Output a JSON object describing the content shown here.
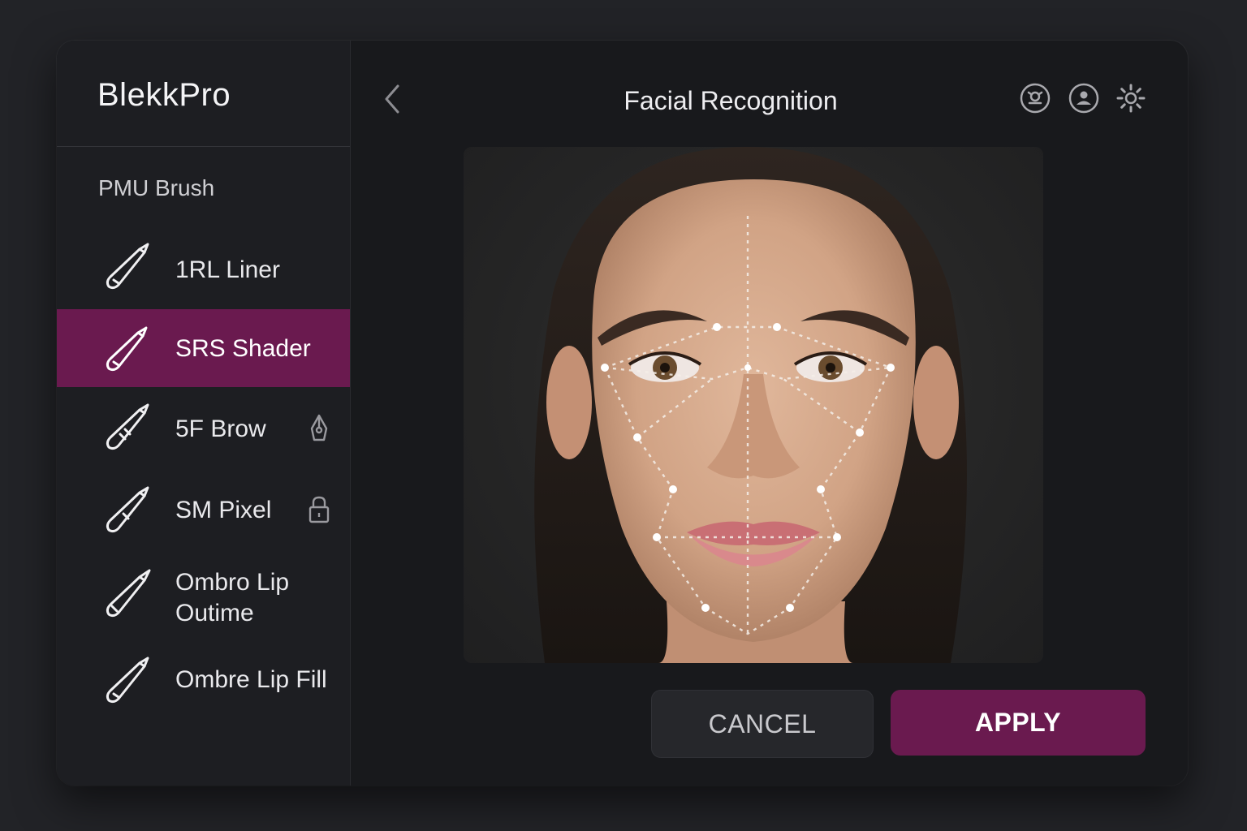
{
  "app": {
    "name": "BlekkPro"
  },
  "sidebar": {
    "section_title": "PMU Brush",
    "items": [
      {
        "label": "1RL Liner",
        "active": false,
        "locked": false,
        "icon": "pen-brush-icon"
      },
      {
        "label": "SRS Shader",
        "active": true,
        "locked": false,
        "icon": "pen-brush-icon"
      },
      {
        "label": "5F Brow",
        "active": false,
        "locked": true,
        "lock_icon": "pen-nib-lock-icon",
        "icon": "pen-brush-icon"
      },
      {
        "label": "SM Pixel",
        "active": false,
        "locked": true,
        "lock_icon": "padlock-icon",
        "icon": "pen-brush-icon"
      },
      {
        "label_line1": "Ombro Lip",
        "label_line2": "Outime",
        "active": false,
        "locked": false,
        "icon": "pen-brush-icon"
      },
      {
        "label": "Ombre Lip Fill",
        "active": false,
        "locked": false,
        "icon": "pen-brush-icon"
      }
    ]
  },
  "header": {
    "title": "Facial Recognition",
    "icons": [
      "face-scan-icon",
      "user-profile-icon",
      "settings-gear-icon"
    ]
  },
  "photo": {
    "subject": "face-portrait-with-landmarks"
  },
  "actions": {
    "cancel_label": "CANCEL",
    "apply_label": "APPLY"
  },
  "colors": {
    "accent": "#6a1a4f",
    "background": "#18191c",
    "sidebar": "#1d1e22"
  }
}
